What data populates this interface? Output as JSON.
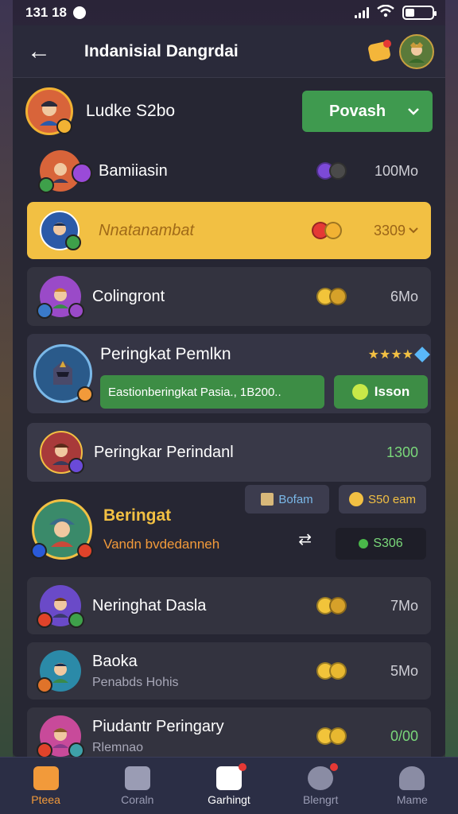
{
  "status": {
    "time": "131 18",
    "battery_level": 0.35
  },
  "header": {
    "title": "Indanisial Dangrdai",
    "back_icon": "back-arrow-icon"
  },
  "profile": {
    "name": "Ludke S2bo",
    "dropdown_label": "Povash"
  },
  "rows": [
    {
      "name": "Bamiiasin",
      "value": "100Mo",
      "coin_colors": [
        "#7c4ad8",
        "#4a4a4a"
      ],
      "avatar_color": "#d8643a",
      "badge_color": "#3ea04a"
    },
    {
      "name": "Nnatanambat",
      "value": "3309",
      "coin_colors": [
        "#e53935",
        "#f2b233"
      ],
      "avatar_color": "#2b5aa8",
      "badge_color": "#3ea04a"
    },
    {
      "name": "Colingront",
      "value": "6Mo",
      "coin_colors": [
        "#f2c43a",
        "#d6a12a"
      ],
      "avatar_color": "#9a4ac8",
      "badge_color": "#9a4ac8"
    }
  ],
  "featured": {
    "title": "Peringkat Pemlkn",
    "stars": "★★★★",
    "subtitle": "Eastionberingkat Pasia., 1B200..",
    "action_label": "Isson"
  },
  "row_plain": {
    "name": "Peringkar Perindanl",
    "value": "1300"
  },
  "event_card": {
    "title": "Beringat",
    "subtitle": "Vandn bvdedanneh",
    "chip1": "Bofam",
    "chip2": "S50 eam",
    "amount": "S306"
  },
  "rows2": [
    {
      "name": "Neringhat Dasla",
      "value": "7Mo",
      "coin_colors": [
        "#f2c43a",
        "#d6a12a"
      ],
      "avatar_color": "#6a4ac8",
      "badge_color": "#3ea04a"
    },
    {
      "name": "Baoka",
      "sub": "Penabds Hohis",
      "value": "5Mo",
      "coin_colors": [
        "#f2c43a",
        "#e8b830"
      ],
      "avatar_color": "#2b8aa8",
      "badge_color": "#e0732a"
    },
    {
      "name": "Piudantr Peringary",
      "sub": "Rlemnao",
      "value": "0/00",
      "coin_colors": [
        "#f2c43a",
        "#e8b830"
      ],
      "avatar_color": "#c84a9a",
      "badge_color": "#3ea0a8"
    }
  ],
  "nav": [
    {
      "label": "Pteea",
      "icon": "home-icon",
      "color": "#f29a3a",
      "active": true
    },
    {
      "label": "Coraln",
      "icon": "box-icon",
      "color": "#9a9cb4",
      "active": false
    },
    {
      "label": "Garhingt",
      "icon": "shield-icon",
      "color": "#ffffff",
      "active": false
    },
    {
      "label": "Blengrt",
      "icon": "chat-icon",
      "color": "#8a8ca4",
      "active": false
    },
    {
      "label": "Mame",
      "icon": "person-icon",
      "color": "#8a8ca4",
      "active": false
    }
  ]
}
